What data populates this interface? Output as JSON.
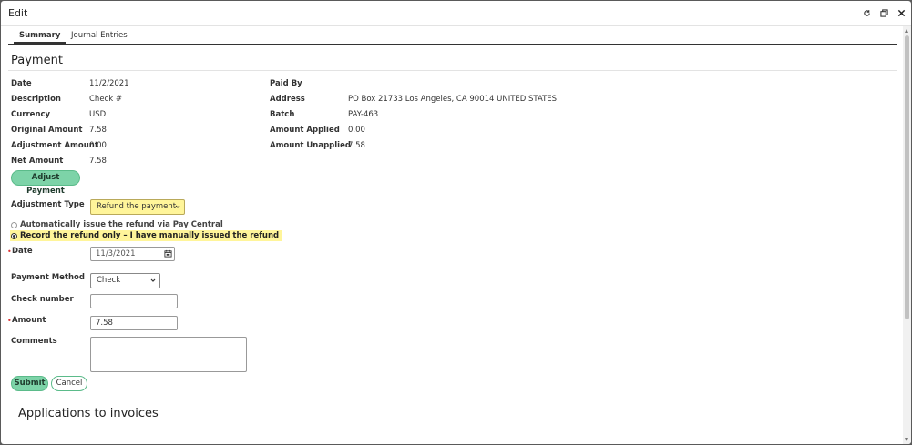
{
  "window": {
    "title": "Edit"
  },
  "tabs": [
    {
      "label": "Summary",
      "active": true
    },
    {
      "label": "Journal Entries",
      "active": false
    }
  ],
  "payment": {
    "heading": "Payment",
    "left": [
      {
        "label": "Date",
        "value": "11/2/2021"
      },
      {
        "label": "Description",
        "value": "Check #"
      },
      {
        "label": "Currency",
        "value": "USD"
      },
      {
        "label": "Original Amount",
        "value": "7.58"
      },
      {
        "label": "Adjustment Amount",
        "value": "0.00"
      },
      {
        "label": "Net Amount",
        "value": "7.58"
      }
    ],
    "right": [
      {
        "label": "Paid By",
        "value": ""
      },
      {
        "label": "Address",
        "value": "PO Box 21733 Los Angeles, CA 90014 UNITED STATES"
      },
      {
        "label": "Batch",
        "value": "PAY-463"
      },
      {
        "label": "Amount Applied",
        "value": "0.00"
      },
      {
        "label": "Amount Unapplied",
        "value": "7.58"
      }
    ],
    "adjust_button": "Adjust Payment"
  },
  "form": {
    "adjustment_type_label": "Adjustment Type",
    "adjustment_type_value": "Refund the payment",
    "radio_auto": "Automatically issue the refund via Pay Central",
    "radio_manual": "Record the refund only – I have manually issued the refund",
    "date_label": "Date",
    "date_value": "11/3/2021",
    "payment_method_label": "Payment Method",
    "payment_method_value": "Check",
    "check_number_label": "Check number",
    "check_number_value": "",
    "amount_label": "Amount",
    "amount_value": "7.58",
    "comments_label": "Comments",
    "required_mark": "•",
    "submit_label": "Submit",
    "cancel_label": "Cancel"
  },
  "applications": {
    "heading": "Applications to invoices"
  },
  "colors": {
    "accent_green": "#7dd3a8",
    "highlight_yellow": "#fff59a"
  }
}
